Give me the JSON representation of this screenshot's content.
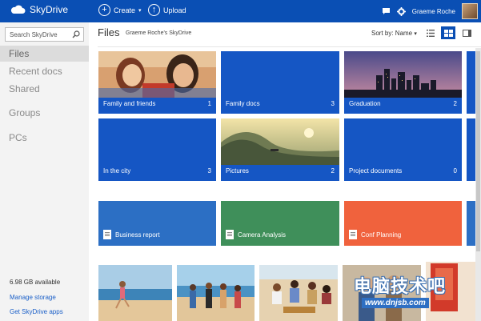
{
  "topbar": {
    "brand": "SkyDrive",
    "create_label": "Create",
    "upload_label": "Upload",
    "user_name": "Graeme Roche"
  },
  "sidebar": {
    "search_placeholder": "Search SkyDrive",
    "items": [
      {
        "label": "Files"
      },
      {
        "label": "Recent docs"
      },
      {
        "label": "Shared"
      },
      {
        "label": "Groups"
      },
      {
        "label": "PCs"
      }
    ],
    "storage_available": "6.98 GB available",
    "manage_storage": "Manage storage",
    "get_apps": "Get SkyDrive apps"
  },
  "main": {
    "title": "Files",
    "breadcrumb": "Graeme Roche's SkyDrive",
    "sort_label": "Sort by: Name"
  },
  "folders": [
    {
      "name": "Family and friends",
      "count": "1"
    },
    {
      "name": "Family docs",
      "count": "3"
    },
    {
      "name": "Graduation",
      "count": "2"
    },
    {
      "name": "In the city",
      "count": "3"
    },
    {
      "name": "Pictures",
      "count": "2"
    },
    {
      "name": "Project documents",
      "count": "0"
    }
  ],
  "documents": [
    {
      "name": "Business report"
    },
    {
      "name": "Camera Analysis"
    },
    {
      "name": "Conf Planning"
    }
  ],
  "watermark": {
    "main": "电脑技术吧",
    "sub": "www.dnjsb.com"
  },
  "colors": {
    "brand_blue": "#0a4fb4",
    "tile_blue": "#1556c4",
    "word_blue": "#2c6fc4",
    "excel_green": "#3f8f5a",
    "ppt_orange": "#f0623d"
  }
}
